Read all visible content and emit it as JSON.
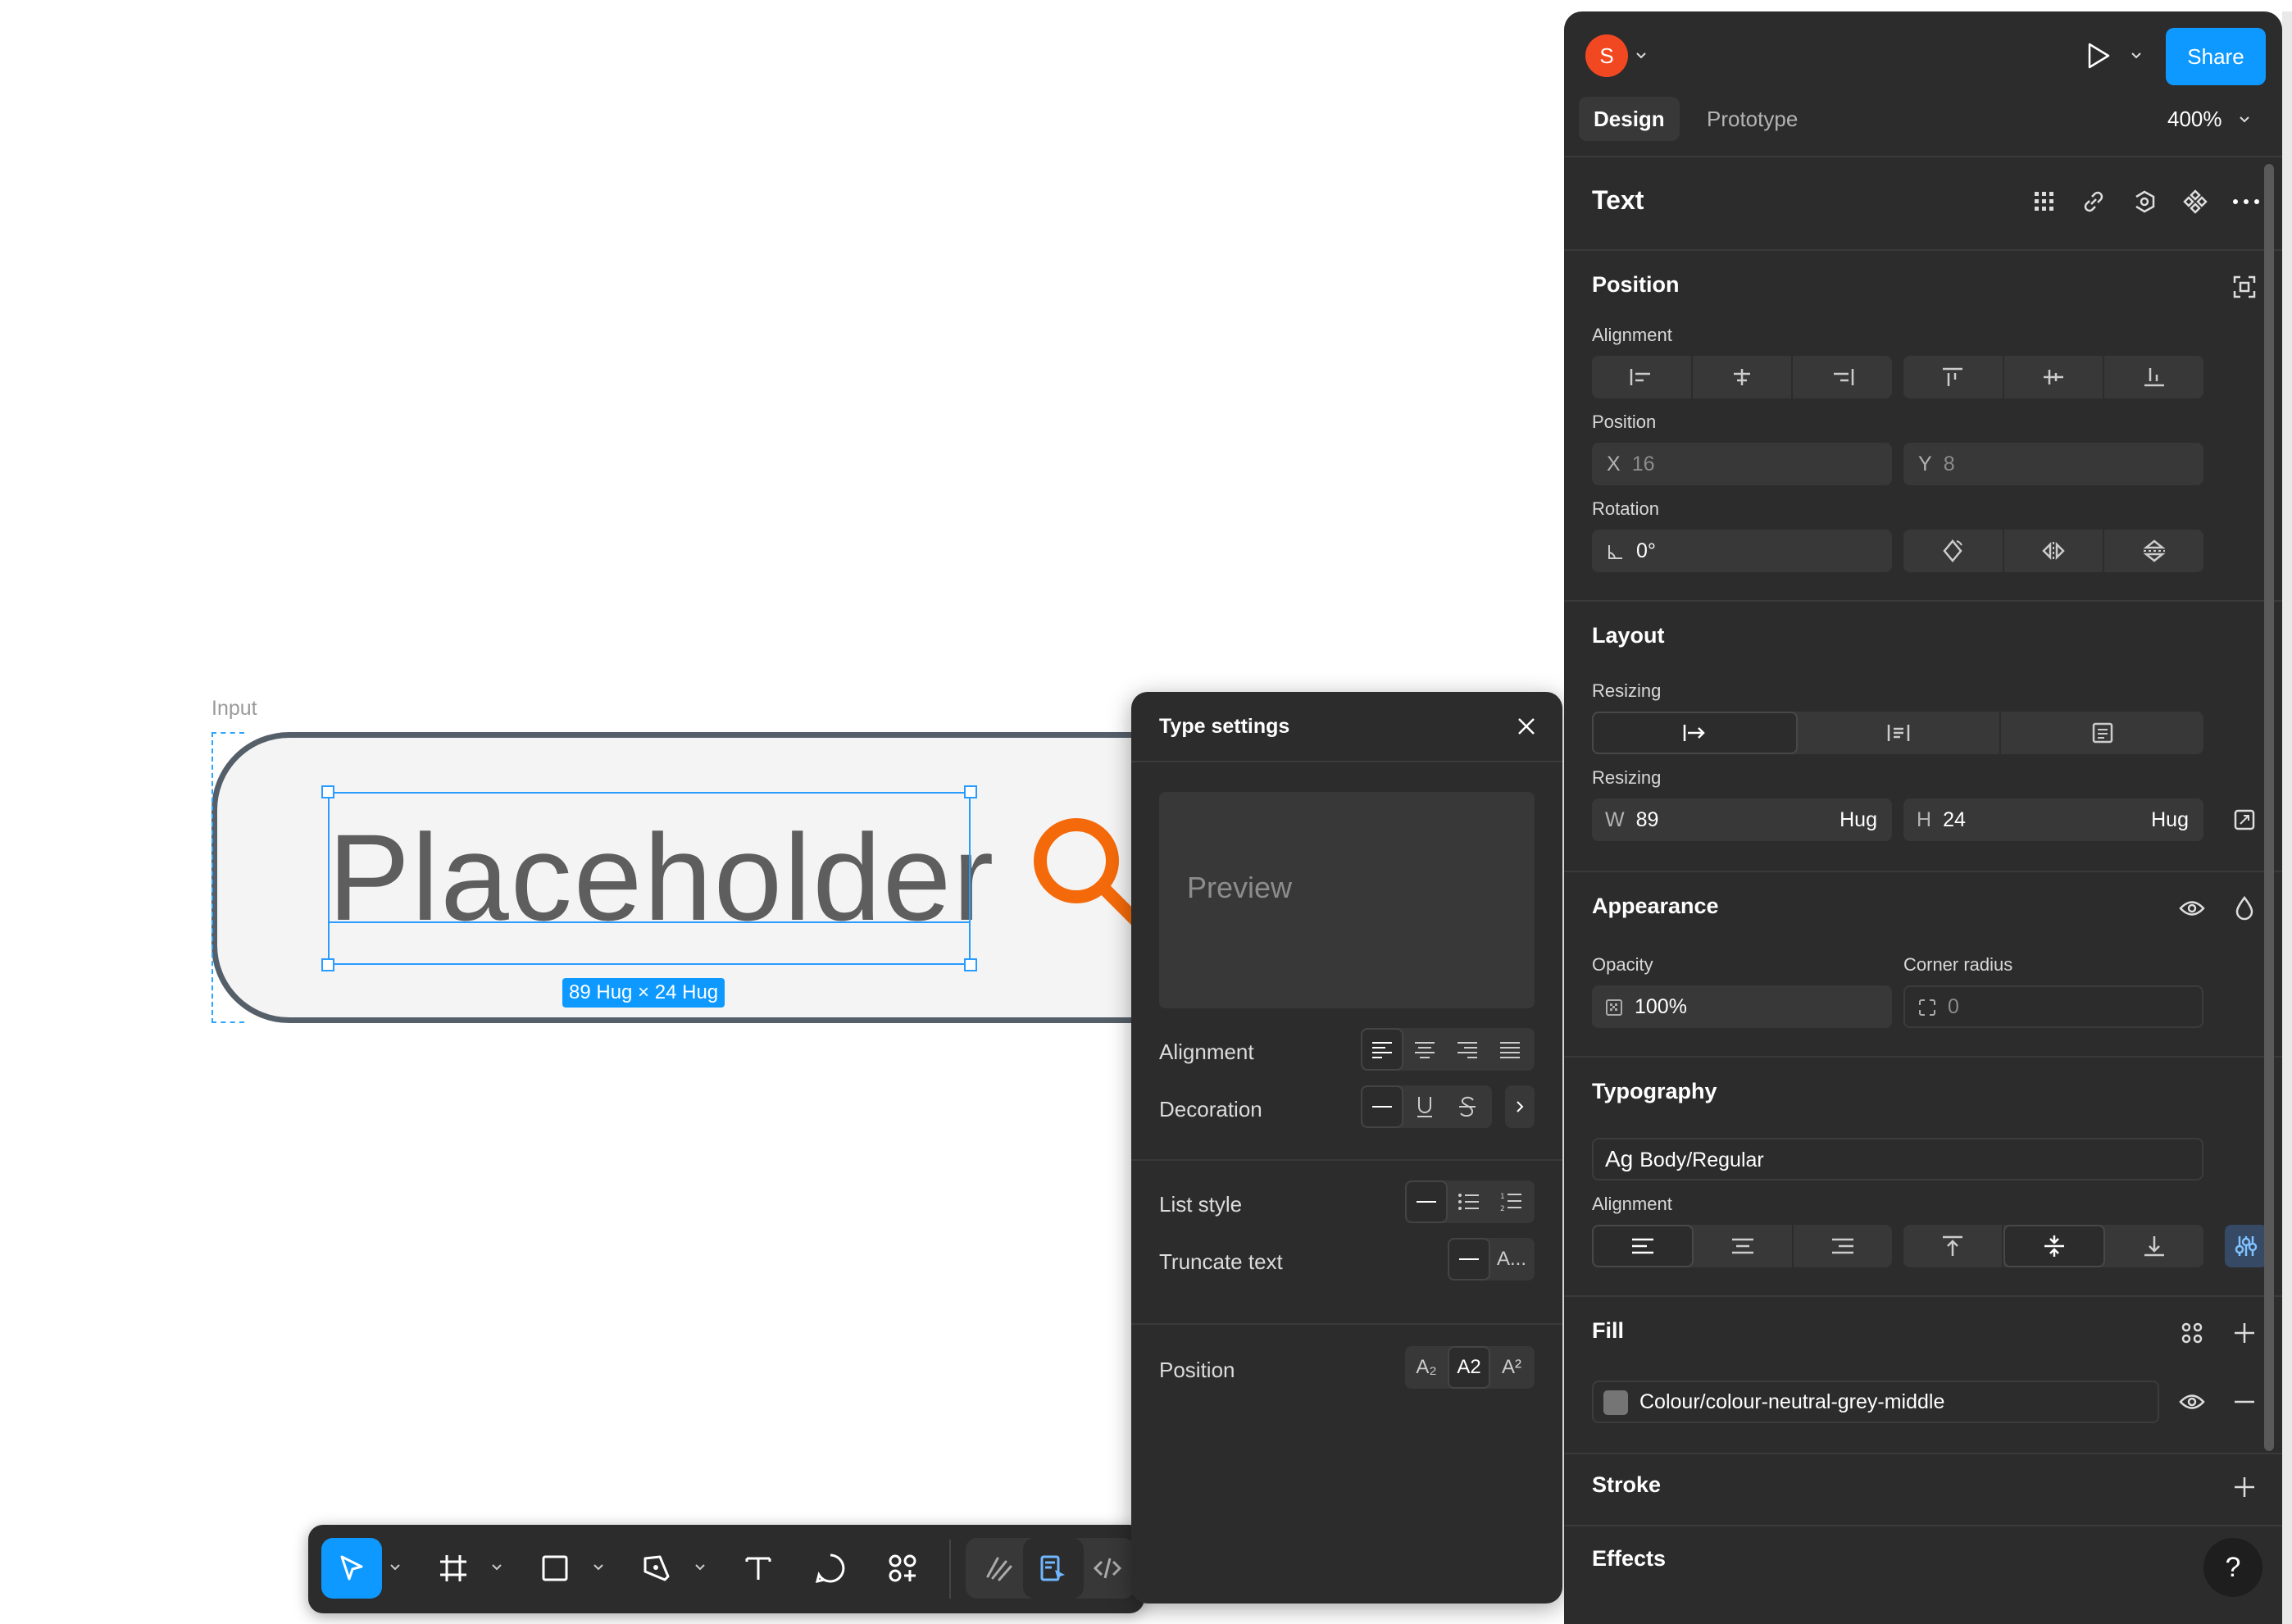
{
  "canvas": {
    "frame_label": "Input",
    "placeholder_text": "Placeholder",
    "size_badge": "89 Hug × 24 Hug"
  },
  "toolbar": {
    "tools": [
      "move-tool",
      "frame-tool",
      "rectangle-tool",
      "pen-tool",
      "text-tool",
      "comment-tool",
      "actions-tool"
    ],
    "modes": [
      "draw-mode",
      "design-mode",
      "dev-mode"
    ]
  },
  "type_settings": {
    "title": "Type settings",
    "preview": "Preview",
    "alignment_label": "Alignment",
    "decoration_label": "Decoration",
    "list_style_label": "List style",
    "truncate_label": "Truncate text",
    "truncate_option": "A...",
    "position_label": "Position",
    "position_options": [
      "A₂",
      "A2",
      "A²"
    ]
  },
  "panel": {
    "avatar_initial": "S",
    "share_label": "Share",
    "tabs": [
      "Design",
      "Prototype"
    ],
    "zoom": "400%",
    "layer_type": "Text",
    "position": {
      "title": "Position",
      "alignment_label": "Alignment",
      "position_label": "Position",
      "x_label": "X",
      "x_value": "16",
      "y_label": "Y",
      "y_value": "8",
      "rotation_label": "Rotation",
      "rotation_value": "0°"
    },
    "layout": {
      "title": "Layout",
      "resizing_label_1": "Resizing",
      "resizing_label_2": "Resizing",
      "w_label": "W",
      "w_value": "89",
      "w_mode": "Hug",
      "h_label": "H",
      "h_value": "24",
      "h_mode": "Hug"
    },
    "appearance": {
      "title": "Appearance",
      "opacity_label": "Opacity",
      "opacity_value": "100%",
      "corner_label": "Corner radius",
      "corner_value": "0"
    },
    "typography": {
      "title": "Typography",
      "style_prefix": "Ag",
      "style_name": "Body/Regular",
      "alignment_label": "Alignment"
    },
    "fill": {
      "title": "Fill",
      "variable": "Colour/colour-neutral-grey-middle",
      "swatch_color": "#757575"
    },
    "stroke_title": "Stroke",
    "effects_title": "Effects",
    "help": "?"
  },
  "colors": {
    "accent": "#0d99ff",
    "avatar": "#f24822",
    "search_icon": "#f46a0a"
  }
}
